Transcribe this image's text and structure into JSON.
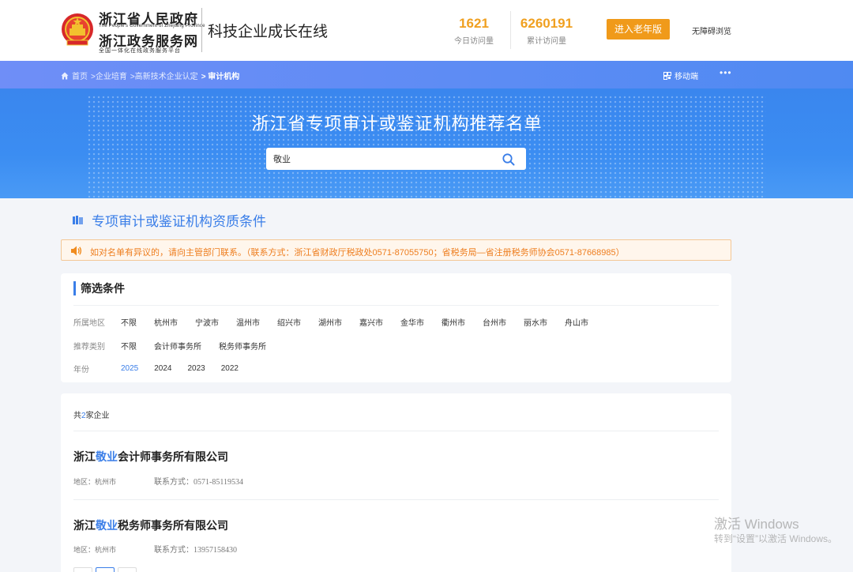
{
  "header": {
    "gov_title": "浙江省人民政府",
    "gov_subtitle": "The People's Government of Zhejiang Province",
    "service_title": "浙江政务服务网",
    "service_subtitle": "全国一体化在线政务服务平台",
    "site_name": "科技企业成长在线",
    "stats": [
      {
        "value": "1621",
        "label": "今日访问量"
      },
      {
        "value": "6260191",
        "label": "累计访问量"
      }
    ],
    "elder_mode_label": "进入老年版",
    "accessibility_label": "无障碍浏览",
    "accent_color": "#f09a1a"
  },
  "breadcrumb": {
    "items": [
      "首页",
      ">企业培育",
      ">高新技术企业认定"
    ],
    "current": "> 审计机构",
    "mobile_label": "移动端",
    "more_label": "•••"
  },
  "banner": {
    "title": "浙江省专项审计或鉴证机构推荐名单",
    "search_value": "敬业"
  },
  "qualification": {
    "title": "专项审计或鉴证机构资质条件"
  },
  "notice": {
    "text": "如对名单有异议的，请向主管部门联系。（联系方式：浙江省财政厅税政处0571-87055750；省税务局—省注册税务师协会0571-87668985）"
  },
  "filter": {
    "title": "筛选条件",
    "region_label": "所属地区",
    "regions": [
      "不限",
      "杭州市",
      "宁波市",
      "温州市",
      "绍兴市",
      "湖州市",
      "嘉兴市",
      "金华市",
      "衢州市",
      "台州市",
      "丽水市",
      "舟山市"
    ],
    "category_label": "推荐类别",
    "categories": [
      "不限",
      "会计师事务所",
      "税务师事务所"
    ],
    "year_label": "年份",
    "years": [
      "2025",
      "2024",
      "2023",
      "2022"
    ],
    "active_color": "#3a7ee8"
  },
  "results": {
    "count_prefix": "共",
    "count": "2",
    "count_suffix": "家企业",
    "items": [
      {
        "name_prefix": "浙江",
        "name_highlight": "敬业",
        "name_suffix": "会计师事务所有限公司",
        "region": "地区：杭州市",
        "contact": "联系方式：0571-85119534"
      },
      {
        "name_prefix": "浙江",
        "name_highlight": "敬业",
        "name_suffix": "税务师事务所有限公司",
        "region": "地区：杭州市",
        "contact": "联系方式：13957158430"
      }
    ]
  },
  "watermark": {
    "line1": "激活 Windows",
    "line2": "转到“设置”以激活 Windows。"
  }
}
